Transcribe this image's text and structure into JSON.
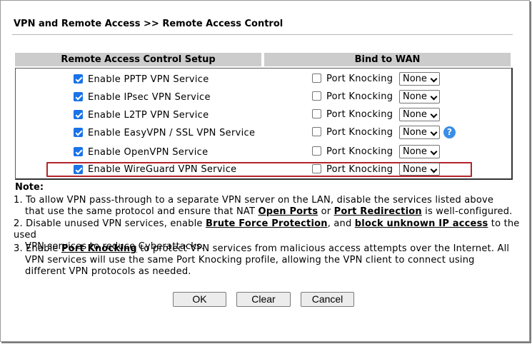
{
  "page": {
    "title": "VPN and Remote Access >> Remote Access Control"
  },
  "table": {
    "header_setup": "Remote Access Control Setup",
    "header_wan": "Bind to WAN",
    "port_knocking_label": "Port Knocking",
    "rows": [
      {
        "label": "Enable PPTP VPN Service",
        "enabled": true,
        "port_knocking": false,
        "wan": "None"
      },
      {
        "label": "Enable IPsec VPN Service",
        "enabled": true,
        "port_knocking": false,
        "wan": "None"
      },
      {
        "label": "Enable L2TP VPN Service",
        "enabled": true,
        "port_knocking": false,
        "wan": "None"
      },
      {
        "label": "Enable EasyVPN / SSL VPN Service",
        "enabled": true,
        "port_knocking": false,
        "wan": "None"
      },
      {
        "label": "Enable OpenVPN Service",
        "enabled": true,
        "port_knocking": false,
        "wan": "None"
      },
      {
        "label": "Enable WireGuard VPN Service",
        "enabled": true,
        "port_knocking": false,
        "wan": "None"
      }
    ],
    "help_glyph": "?"
  },
  "notes": {
    "heading": "Note:",
    "n1": {
      "a": "1. To allow VPN pass-through to a separate VPN server on the LAN, disable the services listed above",
      "b": "that use the same protocol and ensure that NAT ",
      "link1": "Open Ports",
      "c": " or ",
      "link2": "Port Redirection",
      "d": " is well-configured."
    },
    "n2": {
      "a": "2. Disable unused VPN services, enable ",
      "link1": "Brute Force Protection",
      "b": ", and ",
      "link2": "block unknown IP access",
      "c": " to the used",
      "d": "VPN services to reduce Cyberattacks."
    },
    "n3": {
      "a": "3. Enable ",
      "link1": "Port Knocking",
      "b": " to protect VPN services from malicious access attempts over the Internet. All",
      "c": "VPN services will use the same Port Knocking profile, allowing the VPN client to connect using",
      "d": "different VPN protocols as needed."
    }
  },
  "buttons": {
    "ok": "OK",
    "clear": "Clear",
    "cancel": "Cancel"
  },
  "colors": {
    "checkbox_checked": "#1a73e8",
    "header_bg": "#cccccc",
    "highlight_border": "#b5232b",
    "help_icon": "#3a8ee6"
  }
}
